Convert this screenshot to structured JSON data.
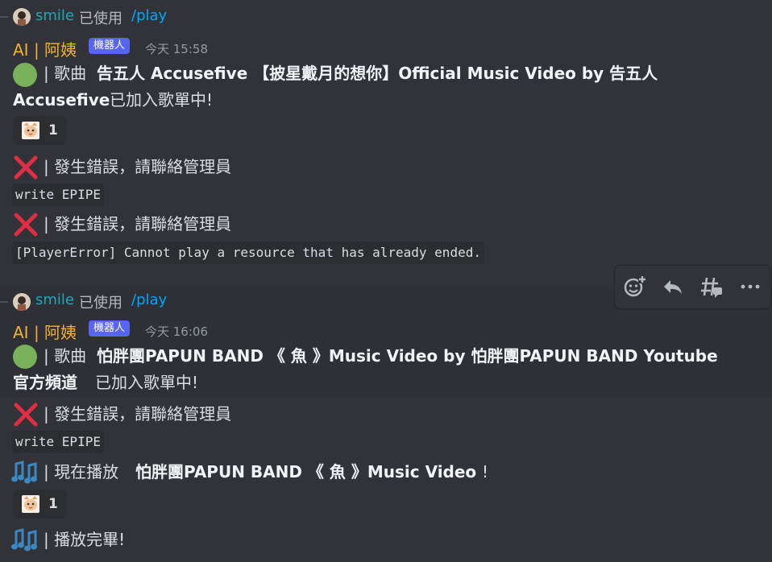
{
  "messages": [
    {
      "reply": {
        "user": "smile",
        "used": "已使用",
        "command": "/play"
      },
      "author": "AI | 阿姨",
      "bot_tag": "機器人",
      "timestamp": "今天 15:58",
      "line1": {
        "sep": "| 歌曲",
        "song": "告五人 Accusefive 【披星戴月的想你】Official Music Video by 告五人",
        "song_cont": "Accusefive",
        "suffix": "已加入歌單中!"
      },
      "reaction_count": "1",
      "errors": [
        {
          "text": "| 發生錯誤，請聯絡管理員",
          "code": "write EPIPE"
        },
        {
          "text": "| 發生錯誤，請聯絡管理員",
          "code": "[PlayerError] Cannot play a resource that has already ended."
        }
      ]
    },
    {
      "reply": {
        "user": "smile",
        "used": "已使用",
        "command": "/play"
      },
      "author": "AI | 阿姨",
      "bot_tag": "機器人",
      "timestamp": "今天 16:06",
      "line1": {
        "sep": "| 歌曲",
        "song": "怕胖團PAPUN BAND 《 魚 》Music Video by 怕胖團PAPUN BAND Youtube",
        "song_cont": "官方頻道",
        "suffix": "已加入歌單中!"
      },
      "error": {
        "text": "| 發生錯誤，請聯絡管理員",
        "code": "write EPIPE"
      },
      "now_playing": {
        "prefix": "| 現在播放",
        "song": "怕胖團PAPUN BAND 《 魚 》Music Video",
        "suffix": "!"
      },
      "reaction_count": "1",
      "finished": "| 播放完畢!"
    }
  ],
  "toolbar": {
    "icons": [
      "add-reaction-icon",
      "reply-icon",
      "create-thread-icon",
      "more-icon"
    ]
  },
  "colors": {
    "background": "#313338",
    "author": "#f0b232",
    "command": "#00a8fc",
    "bot_tag": "#5865f2",
    "error_red": "#dd2e44",
    "green": "#78b159",
    "music_blue": "#3b88c3"
  }
}
